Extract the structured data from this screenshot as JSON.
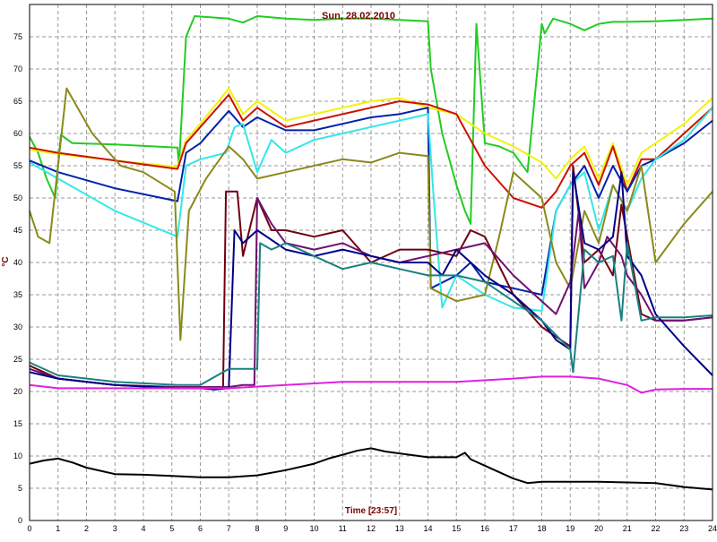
{
  "chart_data": {
    "type": "line",
    "title": "Sun, 28.02.2010",
    "xlabel": "Time [23:57]",
    "ylabel": "°C",
    "xlim": [
      0,
      24
    ],
    "ylim": [
      0,
      80
    ],
    "grid": true,
    "x_ticks": [
      0,
      1,
      2,
      3,
      4,
      5,
      6,
      7,
      8,
      9,
      10,
      11,
      12,
      13,
      14,
      15,
      16,
      17,
      18,
      19,
      20,
      21,
      22,
      23,
      24
    ],
    "y_ticks": [
      0,
      5,
      10,
      15,
      20,
      25,
      30,
      35,
      40,
      45,
      50,
      55,
      60,
      65,
      70,
      75
    ],
    "colors": {
      "green": "#22cc22",
      "yellow": "#f2f20a",
      "red": "#cc1100",
      "blue": "#0022aa",
      "cyan": "#33e8e8",
      "olive": "#8a8a1a",
      "maroon": "#700010",
      "purple": "#701070",
      "navy": "#000088",
      "teal": "#1a8080",
      "magenta": "#e020e0",
      "black": "#000000",
      "marker": "#00aa00"
    },
    "series": [
      {
        "color_key": "green",
        "x": [
          0,
          0.3,
          0.6,
          0.9,
          1.1,
          1.5,
          3,
          5.2,
          5.25,
          5.5,
          5.8,
          7,
          7.5,
          8,
          9,
          10,
          11,
          12,
          13,
          14,
          14.1,
          14.5,
          15,
          15.3,
          15.5,
          15.7,
          16,
          16.5,
          17,
          17.5,
          18,
          18.1,
          18.4,
          19,
          19.5,
          20,
          20.5,
          21,
          22,
          23,
          24
        ],
        "y": [
          59.5,
          57,
          53,
          50,
          59.8,
          58.5,
          58.3,
          57.8,
          55,
          75,
          78.2,
          77.8,
          77.2,
          78.2,
          77.8,
          77.6,
          77.8,
          77.8,
          77.6,
          77.4,
          70,
          60,
          52,
          48,
          46,
          77,
          58.5,
          58,
          57,
          54,
          77,
          75.5,
          77.8,
          77,
          76,
          77,
          77.3,
          77.3,
          77.4,
          77.6,
          77.8
        ]
      },
      {
        "color_key": "yellow",
        "x": [
          0,
          1,
          3,
          5.2,
          5.5,
          6,
          7,
          7.5,
          8,
          9,
          10,
          11,
          12,
          13,
          14,
          15,
          16,
          17,
          18,
          18.5,
          19,
          19.5,
          20,
          20.5,
          21,
          21.5,
          22,
          23,
          24
        ],
        "y": [
          57.5,
          56.8,
          55.8,
          54.8,
          59,
          61.5,
          67,
          63,
          65,
          62,
          63,
          64,
          65,
          65.5,
          64,
          63,
          60,
          58,
          55.5,
          53,
          56,
          58,
          53,
          58.5,
          52,
          57,
          58.5,
          61.5,
          65.5
        ]
      },
      {
        "color_key": "red",
        "x": [
          0,
          1,
          3,
          5.2,
          5.5,
          6,
          7,
          7.5,
          8,
          9,
          10,
          11,
          12,
          13,
          14,
          15,
          16,
          17,
          18,
          18.5,
          19,
          19.5,
          20,
          20.5,
          21,
          21.5,
          22,
          23,
          24
        ],
        "y": [
          57.8,
          57,
          55.8,
          54.5,
          58.5,
          61,
          66,
          62,
          64,
          61,
          62,
          63,
          64,
          65,
          64.5,
          63,
          55,
          50,
          48.5,
          51,
          55,
          57,
          52,
          58,
          51,
          56,
          56,
          60,
          64
        ]
      },
      {
        "color_key": "blue",
        "x": [
          0,
          1,
          3,
          5.2,
          5.5,
          6,
          7,
          7.5,
          8,
          9,
          10,
          11,
          12,
          13,
          14,
          14.1,
          15,
          15.5,
          16,
          17,
          18,
          18.5,
          19,
          19.5,
          20,
          20.5,
          21,
          21.5,
          22,
          23,
          24
        ],
        "y": [
          55.8,
          54,
          51.5,
          49.5,
          57,
          58.5,
          63.5,
          61,
          62.5,
          60.5,
          60.5,
          61.5,
          62.5,
          63,
          64,
          36,
          38,
          40,
          37,
          36,
          35,
          48,
          52,
          55,
          50,
          55,
          51,
          55,
          56,
          58.5,
          62
        ]
      },
      {
        "color_key": "cyan",
        "x": [
          0,
          1,
          3,
          5.2,
          5.5,
          6,
          6.9,
          7.2,
          7.5,
          8,
          8.5,
          9,
          10,
          11,
          12,
          13,
          14,
          14.2,
          14.5,
          15,
          16,
          17,
          18,
          18.5,
          19,
          19.5,
          20,
          20.5,
          21,
          21.5,
          22,
          23,
          24
        ],
        "y": [
          55.5,
          53,
          48,
          44,
          55,
          56,
          57,
          61,
          61.5,
          54,
          59,
          57,
          59,
          60,
          61,
          62,
          63,
          50,
          33,
          38,
          35,
          33,
          32.5,
          48,
          52,
          54,
          45,
          52,
          48,
          53,
          56,
          59,
          64
        ]
      },
      {
        "color_key": "olive",
        "x": [
          0,
          0.3,
          0.7,
          1.3,
          2.2,
          3.2,
          4,
          5.1,
          5.3,
          5.6,
          6.2,
          7,
          7.5,
          8,
          9,
          10,
          11,
          12,
          13,
          14,
          14.1,
          15,
          16,
          16.5,
          17,
          17.5,
          18,
          18.5,
          19,
          19.5,
          20,
          20.5,
          21,
          21.5,
          22,
          23,
          24
        ],
        "y": [
          48,
          44,
          43,
          67,
          60,
          55,
          54,
          51,
          28,
          48,
          53,
          58,
          56,
          53,
          54,
          55,
          56,
          55.5,
          57,
          56.5,
          36,
          34,
          35,
          44,
          54,
          52,
          50,
          40,
          36,
          48,
          43,
          52,
          48,
          55,
          40,
          46,
          51
        ]
      },
      {
        "color_key": "maroon",
        "x": [
          0,
          1,
          3,
          5.2,
          6,
          6.8,
          6.9,
          7.3,
          7.5,
          8,
          8.5,
          9,
          10,
          11,
          12,
          13,
          14,
          15,
          15.5,
          16,
          17,
          18,
          19,
          19.1,
          19.5,
          20,
          20.5,
          20.8,
          21,
          21.5,
          22,
          23,
          24
        ],
        "y": [
          24,
          22,
          21,
          20.5,
          20.5,
          20.5,
          51,
          51,
          41,
          50,
          45,
          45,
          44,
          45,
          40,
          42,
          42,
          41,
          45,
          44,
          35,
          30,
          27,
          55,
          40,
          42,
          38,
          49,
          44,
          32,
          31,
          31,
          31.5
        ]
      },
      {
        "color_key": "purple",
        "x": [
          0,
          1,
          3,
          5.2,
          6,
          7,
          7.5,
          7.9,
          8,
          8.5,
          9,
          10,
          11,
          12,
          13,
          14,
          15,
          16,
          17,
          18,
          18.5,
          19,
          19.3,
          19.5,
          20,
          20.3,
          20.8,
          21,
          21.5,
          22,
          23,
          24
        ],
        "y": [
          23.5,
          22,
          21,
          20.7,
          20.7,
          20.7,
          21,
          21,
          50,
          46,
          43,
          42,
          43,
          41,
          40,
          41,
          42,
          43,
          38,
          34,
          32,
          37,
          48,
          36,
          40,
          44,
          41,
          38,
          35,
          31,
          31,
          31.5
        ]
      },
      {
        "color_key": "navy",
        "x": [
          0,
          1,
          3,
          5.2,
          6,
          6.5,
          7,
          7.2,
          7.5,
          8,
          9,
          10,
          11,
          12,
          13,
          14,
          14.5,
          15,
          16,
          17,
          18,
          18.5,
          19,
          19.1,
          19.5,
          20,
          20.5,
          20.8,
          21,
          21.5,
          22,
          23,
          24
        ],
        "y": [
          23,
          22,
          21,
          20.5,
          20.5,
          20.3,
          20.5,
          45,
          43,
          45,
          42,
          41,
          42,
          41,
          40,
          40,
          38,
          42,
          38,
          35,
          31,
          28,
          26.5,
          54,
          43,
          42,
          44,
          54,
          41,
          38,
          32,
          27,
          22.5
        ]
      },
      {
        "color_key": "teal",
        "x": [
          0,
          1,
          3,
          5.2,
          6,
          7,
          7.5,
          8,
          8.1,
          8.5,
          9,
          10,
          11,
          12,
          13,
          14,
          15,
          16,
          17,
          18,
          19,
          19.1,
          19.5,
          20,
          20.5,
          20.8,
          21,
          21.5,
          22,
          23,
          24
        ],
        "y": [
          24.5,
          22.5,
          21.5,
          21,
          21,
          23.5,
          23.5,
          23.5,
          43,
          42,
          43,
          41,
          39,
          40,
          39,
          38,
          38,
          37,
          34,
          31,
          26.5,
          23,
          42,
          40,
          41,
          31,
          43,
          31,
          31.5,
          31.5,
          31.8
        ]
      },
      {
        "color_key": "magenta",
        "x": [
          0,
          1,
          3,
          5,
          7,
          9,
          11,
          13,
          15,
          17,
          18,
          19,
          20,
          21,
          21.5,
          22,
          23,
          24
        ],
        "y": [
          21,
          20.5,
          20.5,
          20.5,
          20.5,
          21,
          21.5,
          21.5,
          21.5,
          22,
          22.3,
          22.3,
          22,
          21,
          19.8,
          20.3,
          20.4,
          20.4
        ]
      },
      {
        "color_key": "black",
        "x": [
          0,
          0.5,
          1,
          1.5,
          2,
          3,
          4,
          5,
          6,
          7,
          8,
          9,
          10,
          10.5,
          11,
          11.5,
          12,
          12.5,
          13,
          14,
          15,
          15.3,
          15.5,
          16,
          17,
          17.5,
          18,
          19,
          20,
          21,
          22,
          23,
          24
        ],
        "y": [
          8.8,
          9.3,
          9.6,
          9,
          8.2,
          7.2,
          7.1,
          6.9,
          6.7,
          6.7,
          7,
          7.8,
          8.8,
          9.6,
          10.2,
          10.8,
          11.2,
          10.7,
          10.4,
          9.8,
          9.8,
          10.5,
          9.5,
          8.5,
          6.5,
          5.8,
          6,
          6,
          6,
          5.9,
          5.8,
          5.2,
          4.8
        ]
      }
    ]
  }
}
